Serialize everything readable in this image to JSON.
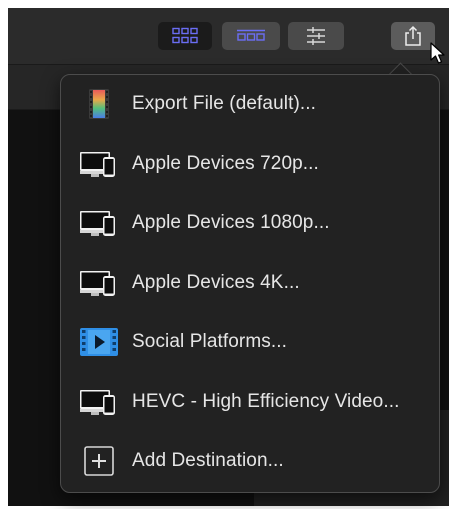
{
  "toolbar": {
    "buttons": [
      {
        "name": "grid-view-button",
        "icon": "grid-view-icon"
      },
      {
        "name": "filmstrip-view-button",
        "icon": "filmstrip-view-icon"
      },
      {
        "name": "adjustments-button",
        "icon": "sliders-icon"
      },
      {
        "name": "share-button",
        "icon": "share-icon"
      }
    ],
    "accent": "#5a5cf0"
  },
  "menu": {
    "items": [
      {
        "label": "Export File (default)...",
        "icon": "film-strip-icon"
      },
      {
        "label": "Apple Devices 720p...",
        "icon": "apple-devices-icon"
      },
      {
        "label": "Apple Devices 1080p...",
        "icon": "apple-devices-icon"
      },
      {
        "label": "Apple Devices 4K...",
        "icon": "apple-devices-icon"
      },
      {
        "label": "Social Platforms...",
        "icon": "social-platforms-icon"
      },
      {
        "label": "HEVC - High Efficiency Video...",
        "icon": "apple-devices-icon"
      },
      {
        "label": "Add Destination...",
        "icon": "add-icon"
      }
    ]
  }
}
